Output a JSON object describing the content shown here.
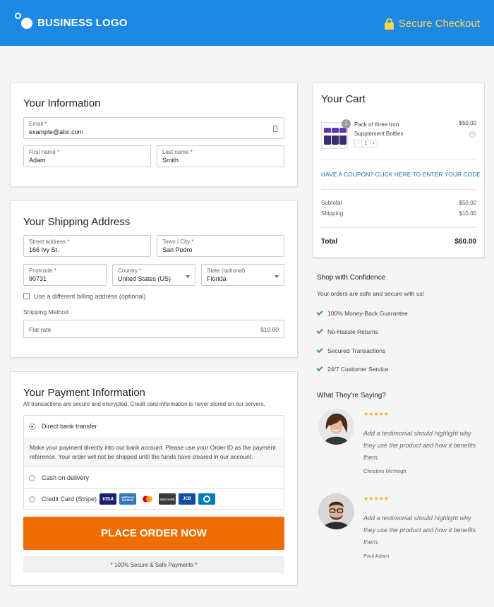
{
  "header": {
    "brand": "BUSINESS LOGO",
    "secure_label": "Secure Checkout",
    "bg_color": "#1e88e5",
    "secure_color": "#ffd54f"
  },
  "info": {
    "title": "Your Information",
    "email": {
      "label": "Email *",
      "value": "example@abc.com"
    },
    "first_name": {
      "label": "First name *",
      "value": "Adam"
    },
    "last_name": {
      "label": "Last name *",
      "value": "Smith"
    }
  },
  "shipping": {
    "title": "Your Shipping Address",
    "street": {
      "label": "Street address *",
      "value": "166 Ivy St."
    },
    "town": {
      "label": "Town / City *",
      "value": "San Pedro"
    },
    "postcode": {
      "label": "Postcode *",
      "value": "90731"
    },
    "country": {
      "label": "Country *",
      "value": "United States (US)"
    },
    "state": {
      "label": "State (optional)",
      "value": "Florida"
    },
    "billing_checkbox_label": "Use a different billing address (optional)",
    "method_label": "Shipping Method",
    "method_name": "Flat rate",
    "method_price": "$10.00"
  },
  "payment": {
    "title": "Your Payment Information",
    "subtitle": "All transactions are secure and encrypted. Credit card information is never stored on our servers.",
    "options": [
      {
        "label": "Direct bank transfer",
        "selected": true
      },
      {
        "label": "Cash on delivery",
        "selected": false
      },
      {
        "label": "Credit Card (Stripe)",
        "selected": false
      }
    ],
    "bank_description": "Make your payment directly into our bank account. Please use your Order ID as the payment reference. Your order will not be shipped until the funds have cleared in our account.",
    "cards": [
      "VISA",
      "AMERICAN EXPRESS",
      "mastercard",
      "DISCOVER",
      "JCB",
      "Diners Club"
    ],
    "place_order_label": "PLACE ORDER NOW",
    "place_order_color": "#ef6c00",
    "secure_note": "* 100% Secure & Safe Payments *"
  },
  "cart": {
    "title": "Your Cart",
    "item": {
      "name": "Pack of three Iron Supplement Bottles",
      "price": "$50.00",
      "quantity": "1",
      "badge": "1",
      "minus": "-",
      "plus": "+"
    },
    "coupon_link": "HAVE A COUPON? CLICK HERE TO ENTER YOUR CODE",
    "subtotal_label": "Subtotal",
    "subtotal_value": "$50.00",
    "shipping_label": "Shipping",
    "shipping_value": "$10.00",
    "total_label": "Total",
    "total_value": "$60.00"
  },
  "confidence": {
    "title": "Shop with Confidence",
    "subtitle": "Your orders are safe and secure with us!",
    "items": [
      "100% Money-Back Guarantee",
      "No-Hassle Returns",
      "Secured Transactions",
      "24/7 Customer Service"
    ],
    "check_color": "#43a047"
  },
  "testimonials": {
    "title": "What They're Saying?",
    "items": [
      {
        "stars": "★★★★★",
        "quote": "Add a testimonial should highlight why they use the product and how it benefits them.",
        "author": "Christine McVeigh"
      },
      {
        "stars": "★★★★★",
        "quote": "Add a testimonial should highlight why they use the product and how it benefits them.",
        "author": "Paul Adam"
      }
    ]
  }
}
